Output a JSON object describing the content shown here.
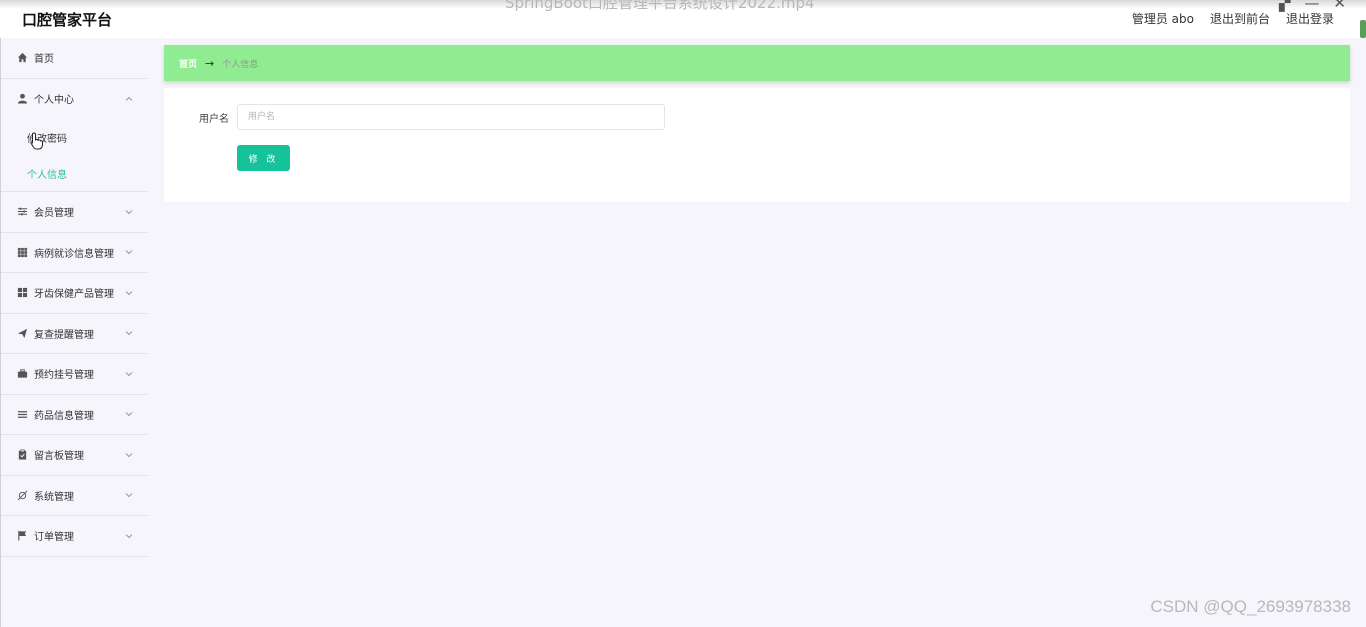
{
  "header": {
    "brand": "口腔管家平台",
    "video_title": "SpringBoot口腔管理平台系统设计2022.mp4",
    "user_label": "管理员 abo",
    "front_link": "退出到前台",
    "logout_link": "退出登录"
  },
  "sidebar": {
    "home": "首页",
    "personal_center": {
      "label": "个人中心",
      "children": [
        "修改密码",
        "个人信息"
      ],
      "active_child": "个人信息"
    },
    "items": [
      {
        "label": "会员管理",
        "icon": "sliders-icon"
      },
      {
        "label": "病例就诊信息管理",
        "icon": "grid-icon"
      },
      {
        "label": "牙齿保健产品管理",
        "icon": "apps-icon"
      },
      {
        "label": "复查提醒管理",
        "icon": "send-icon"
      },
      {
        "label": "预约挂号管理",
        "icon": "briefcase-icon"
      },
      {
        "label": "药品信息管理",
        "icon": "list-icon"
      },
      {
        "label": "留言板管理",
        "icon": "clipboard-icon"
      },
      {
        "label": "系统管理",
        "icon": "settings-off-icon"
      },
      {
        "label": "订单管理",
        "icon": "flag-icon"
      }
    ]
  },
  "breadcrumb": {
    "home": "首页",
    "separator": "→",
    "current": "个人信息"
  },
  "form": {
    "username_label": "用户名",
    "username_placeholder": "用户名",
    "username_value": "",
    "submit_label": "修 改"
  },
  "watermark": "CSDN @QQ_2693978338",
  "colors": {
    "accent": "#16c29a",
    "breadcrumb_bg": "#90ec90",
    "active_menu": "#2bbf9a"
  }
}
